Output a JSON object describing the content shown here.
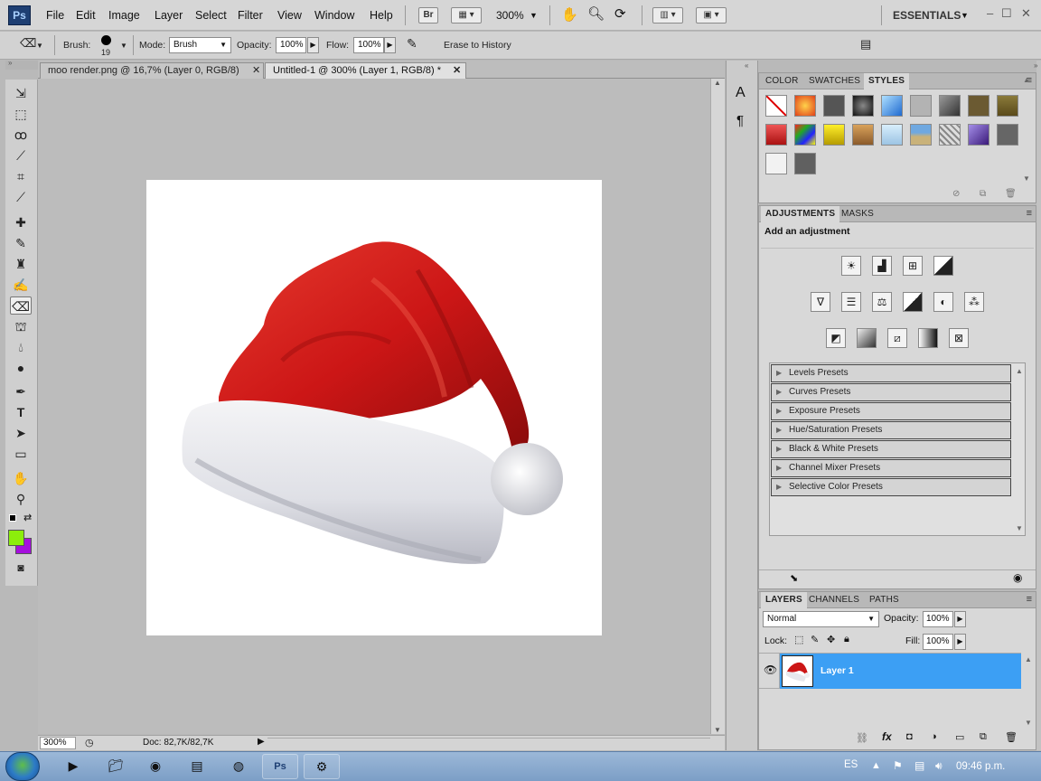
{
  "app": {
    "logo": "Ps",
    "menu": [
      "File",
      "Edit",
      "Image",
      "Layer",
      "Select",
      "Filter",
      "View",
      "Window",
      "Help"
    ],
    "bridge_label": "Br",
    "zoom_value": "300%",
    "workspace": "ESSENTIALS",
    "window_buttons": [
      "–",
      "☐",
      "✕"
    ]
  },
  "options": {
    "brush_label": "Brush:",
    "brush_size": "19",
    "mode_label": "Mode:",
    "mode_value": "Brush",
    "opacity_label": "Opacity:",
    "opacity_value": "100%",
    "flow_label": "Flow:",
    "flow_value": "100%",
    "erase_history_label": "Erase to History"
  },
  "tabs": [
    {
      "label": "moo render.png @ 16,7% (Layer 0, RGB/8)",
      "close": "✕",
      "active": false
    },
    {
      "label": "Untitled-1 @ 300% (Layer 1, RGB/8) *",
      "close": "✕",
      "active": true
    }
  ],
  "status": {
    "zoom": "300%",
    "doc": "Doc: 82,7K/82,7K"
  },
  "colors": {
    "foreground": "#8cee0c",
    "background": "#a50fdd",
    "layer_selected": "#3c9ff4",
    "hat_red": "#cc1616"
  },
  "styles_panel": {
    "tabs": [
      "COLOR",
      "SWATCHES",
      "STYLES"
    ],
    "active_tab": "STYLES"
  },
  "adjustments_panel": {
    "tabs": [
      "ADJUSTMENTS",
      "MASKS"
    ],
    "heading": "Add an adjustment",
    "presets": [
      "Levels Presets",
      "Curves Presets",
      "Exposure Presets",
      "Hue/Saturation Presets",
      "Black & White Presets",
      "Channel Mixer Presets",
      "Selective Color Presets"
    ]
  },
  "layers_panel": {
    "tabs": [
      "LAYERS",
      "CHANNELS",
      "PATHS"
    ],
    "blend_mode": "Normal",
    "opacity_label": "Opacity:",
    "opacity_value": "100%",
    "lock_label": "Lock:",
    "fill_label": "Fill:",
    "fill_value": "100%",
    "layers": [
      {
        "name": "Layer 1",
        "visible": true,
        "selected": true
      }
    ]
  },
  "taskbar": {
    "language": "ES",
    "time": "09:46 p.m."
  }
}
